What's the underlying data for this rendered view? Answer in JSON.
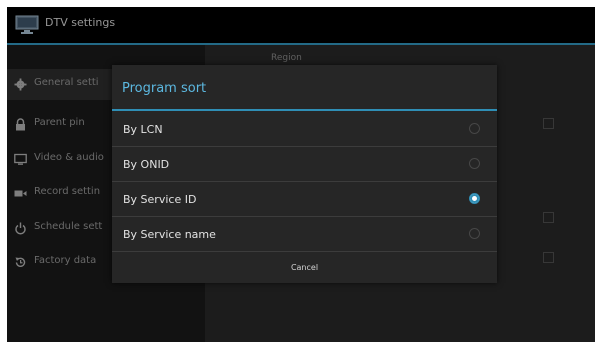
{
  "window": {
    "title": "DTV settings"
  },
  "sidebar": {
    "items": [
      {
        "label": "General setti",
        "icon": "gear-icon",
        "selected": true
      },
      {
        "label": "Parent pin",
        "icon": "lock-icon",
        "selected": false
      },
      {
        "label": "Video & audio",
        "icon": "monitor-icon",
        "selected": false
      },
      {
        "label": "Record settin",
        "icon": "camera-icon",
        "selected": false
      },
      {
        "label": "Schedule sett",
        "icon": "power-icon",
        "selected": false
      },
      {
        "label": "Factory data",
        "icon": "reset-icon",
        "selected": false
      }
    ]
  },
  "content": {
    "header": "Region"
  },
  "dialog": {
    "title": "Program sort",
    "options": [
      {
        "label": "By LCN",
        "checked": false
      },
      {
        "label": "By ONID",
        "checked": false
      },
      {
        "label": "By Service ID",
        "checked": true
      },
      {
        "label": "By Service name",
        "checked": false
      }
    ],
    "cancel_label": "Cancel"
  },
  "colors": {
    "accent": "#2f8eb5",
    "dialog_title": "#5cb8e0",
    "background": "#0b0b0b"
  }
}
